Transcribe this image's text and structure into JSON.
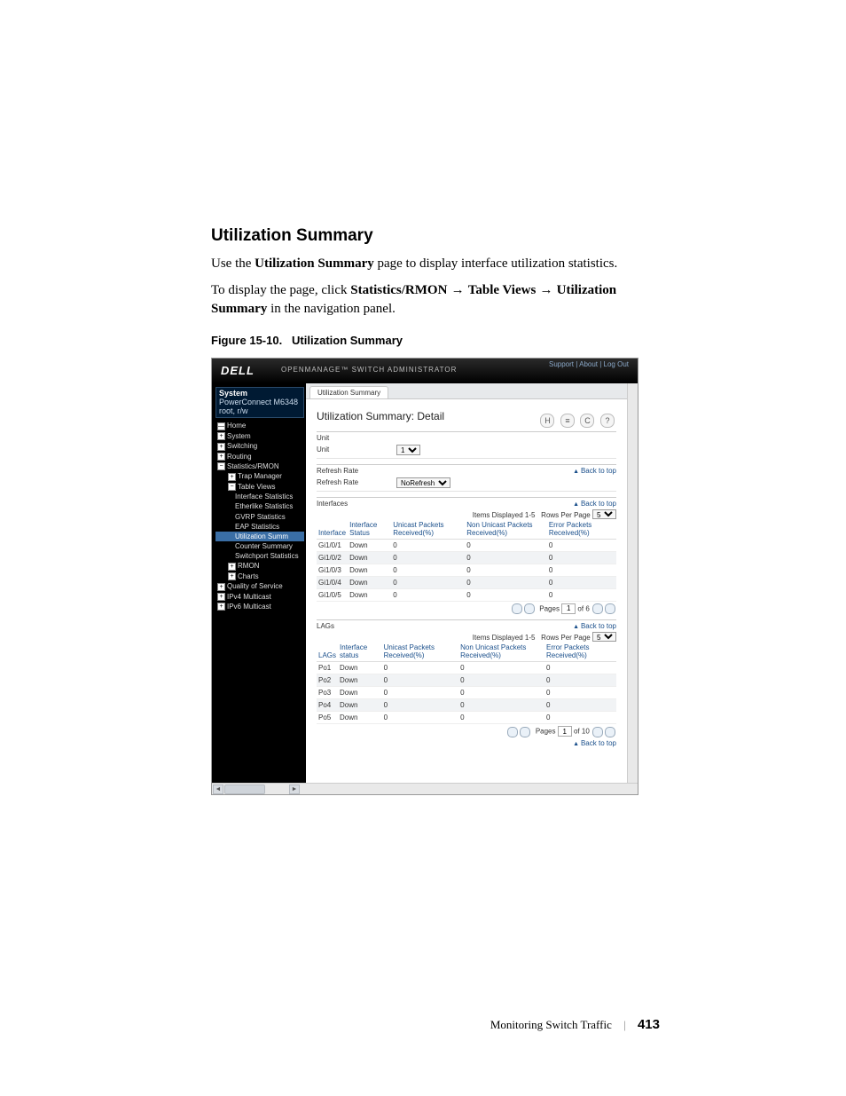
{
  "section_heading": "Utilization Summary",
  "intro_sentence_pre": "Use the ",
  "intro_bold": "Utilization Summary",
  "intro_sentence_post": " page to display interface utilization statistics.",
  "instr_pre": "To display the page, click ",
  "instr_b1": "Statistics/RMON",
  "arrow": " → ",
  "instr_b2": "Table Views",
  "instr_b3": "Utilization Summary",
  "instr_post": " in the navigation panel.",
  "fig_caption_num": "Figure 15-10.",
  "fig_caption_title": "Utilization Summary",
  "footer_text": "Monitoring Switch Traffic",
  "footer_page": "413",
  "shot": {
    "logo": "DELL",
    "subtitle": "OPENMANAGE™ SWITCH ADMINISTRATOR",
    "top_links": "Support | About | Log Out",
    "sidebar": {
      "sys_title": "System",
      "sys_sub1": "PowerConnect M6348",
      "sys_sub2": "root, r/w",
      "items": {
        "home": "Home",
        "system": "System",
        "switching": "Switching",
        "routing": "Routing",
        "stats": "Statistics/RMON",
        "trap": "Trap Manager",
        "tableviews": "Table Views",
        "ifstats": "Interface Statistics",
        "ethstats": "Etherlike Statistics",
        "gvrp": "GVRP Statistics",
        "eap": "EAP Statistics",
        "util": "Utilization Summ",
        "counter": "Counter Summary",
        "switchport": "Switchport Statistics",
        "rmon": "RMON",
        "charts": "Charts",
        "qos": "Quality of Service",
        "ipv4": "IPv4 Multicast",
        "ipv6": "IPv6 Multicast"
      }
    },
    "main": {
      "tab": "Utilization Summary",
      "title": "Utilization Summary: Detail",
      "icons": {
        "save": "H",
        "print": "≡",
        "refresh": "C",
        "help": "?"
      },
      "unit_label": "Unit",
      "unit_row_label": "Unit",
      "unit_value": "1",
      "refresh_label": "Refresh Rate",
      "refresh_row_label": "Refresh Rate",
      "refresh_value": "NoRefresh",
      "back_to_top": "Back to top",
      "interfaces_label": "Interfaces",
      "lags_label": "LAGs",
      "items_displayed_if": "Items Displayed 1-5",
      "items_displayed_lag": "Items Displayed 1-5",
      "rows_per_page": "Rows Per Page",
      "rows_value": "5",
      "if_cols": {
        "c1": "Interface",
        "c2": "Interface Status",
        "c3": "Unicast Packets Received(%)",
        "c4": "Non Unicast Packets Received(%)",
        "c5": "Error Packets Received(%)"
      },
      "lag_cols": {
        "c1": "LAGs",
        "c2": "Interface status",
        "c3": "Unicast Packets Received(%)",
        "c4": "Non Unicast Packets Received(%)",
        "c5": "Error Packets Received(%)"
      },
      "if_rows": [
        {
          "a": "Gi1/0/1",
          "b": "Down",
          "c": "0",
          "d": "0",
          "e": "0"
        },
        {
          "a": "Gi1/0/2",
          "b": "Down",
          "c": "0",
          "d": "0",
          "e": "0"
        },
        {
          "a": "Gi1/0/3",
          "b": "Down",
          "c": "0",
          "d": "0",
          "e": "0"
        },
        {
          "a": "Gi1/0/4",
          "b": "Down",
          "c": "0",
          "d": "0",
          "e": "0"
        },
        {
          "a": "Gi1/0/5",
          "b": "Down",
          "c": "0",
          "d": "0",
          "e": "0"
        }
      ],
      "lag_rows": [
        {
          "a": "Po1",
          "b": "Down",
          "c": "0",
          "d": "0",
          "e": "0"
        },
        {
          "a": "Po2",
          "b": "Down",
          "c": "0",
          "d": "0",
          "e": "0"
        },
        {
          "a": "Po3",
          "b": "Down",
          "c": "0",
          "d": "0",
          "e": "0"
        },
        {
          "a": "Po4",
          "b": "Down",
          "c": "0",
          "d": "0",
          "e": "0"
        },
        {
          "a": "Po5",
          "b": "Down",
          "c": "0",
          "d": "0",
          "e": "0"
        }
      ],
      "pages_label": "Pages",
      "if_page_cur": "1",
      "if_page_total": "of 6",
      "lag_page_cur": "1",
      "lag_page_total": "of 10"
    }
  }
}
